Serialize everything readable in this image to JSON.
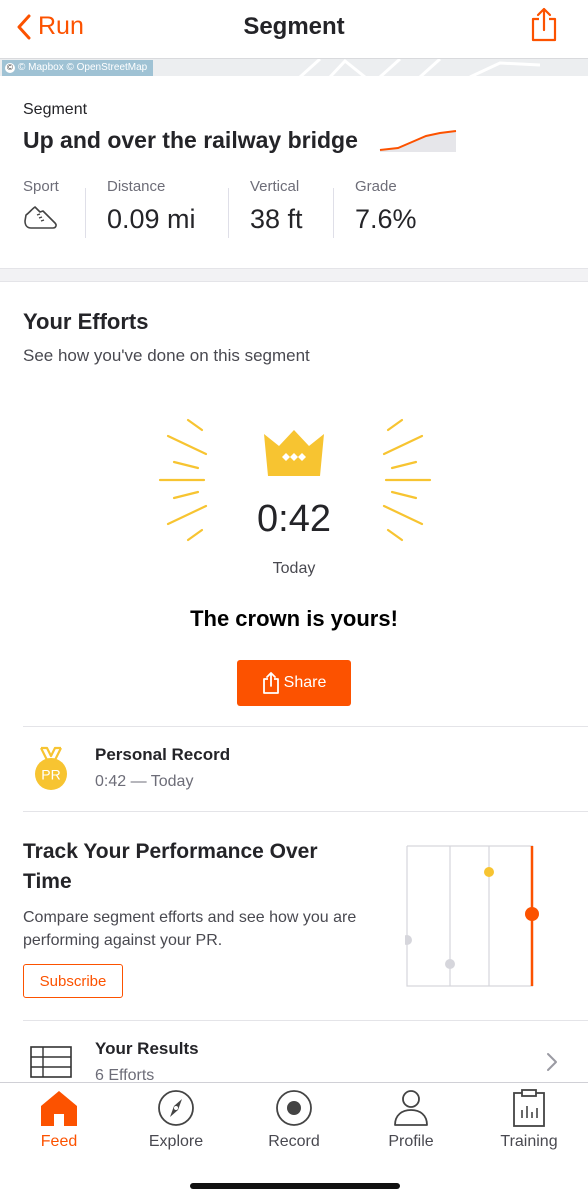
{
  "header": {
    "back_label": "Run",
    "title": "Segment"
  },
  "map": {
    "attribution": "© Mapbox © OpenStreetMap",
    "attribution_symbol": "©"
  },
  "segment": {
    "label": "Segment",
    "name": "Up and over the railway bridge",
    "stats": [
      {
        "label": "Sport",
        "value": "",
        "icon": "shoe-icon"
      },
      {
        "label": "Distance",
        "value": "0.09 mi"
      },
      {
        "label": "Vertical",
        "value": "38 ft"
      },
      {
        "label": "Grade",
        "value": "7.6%"
      }
    ]
  },
  "efforts": {
    "title": "Your Efforts",
    "subtitle": "See how you've done on this segment",
    "time": "0:42",
    "date": "Today",
    "headline": "The crown is yours!",
    "share_label": "Share"
  },
  "personal_record": {
    "badge": "PR",
    "title": "Personal Record",
    "detail": "0:42 — Today"
  },
  "track": {
    "title": "Track Your Performance Over Time",
    "description": "Compare segment efforts and see how you are performing against your PR.",
    "subscribe_label": "Subscribe"
  },
  "results": {
    "title": "Your Results",
    "detail": "6 Efforts"
  },
  "tabs": [
    {
      "label": "Feed",
      "icon": "home-icon",
      "active": true
    },
    {
      "label": "Explore",
      "icon": "compass-icon",
      "active": false
    },
    {
      "label": "Record",
      "icon": "record-icon",
      "active": false
    },
    {
      "label": "Profile",
      "icon": "person-icon",
      "active": false
    },
    {
      "label": "Training",
      "icon": "clipboard-chart-icon",
      "active": false
    }
  ],
  "colors": {
    "accent": "#fc5200",
    "crown": "#f7c431",
    "text": "#242428",
    "muted": "#6d6d78"
  }
}
